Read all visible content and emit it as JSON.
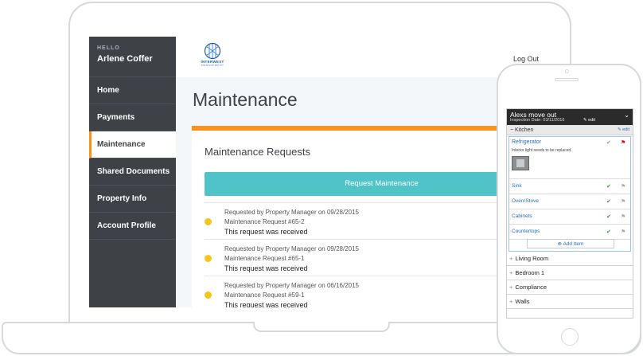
{
  "sidebar": {
    "greeting": "HELLO",
    "user_name": "Arlene Coffer",
    "items": [
      {
        "label": "Home"
      },
      {
        "label": "Payments"
      },
      {
        "label": "Maintenance"
      },
      {
        "label": "Shared Documents"
      },
      {
        "label": "Property Info"
      },
      {
        "label": "Account Profile"
      }
    ],
    "active_item": "Maintenance"
  },
  "header": {
    "logo_text": "INTERWEST",
    "logo_subtext": "MANAGEMENT",
    "logout_label": "Log Out"
  },
  "main": {
    "page_title": "Maintenance",
    "panel_title": "Maintenance Requests",
    "request_button_label": "Request Maintenance",
    "requests": [
      {
        "requested_by": "Requested by Property Manager on 09/28/2015",
        "request_id": "Maintenance Request #65-2",
        "status": "This request was received"
      },
      {
        "requested_by": "Requested by Property Manager on 09/28/2015",
        "request_id": "Maintenance Request #65-1",
        "status": "This request was received"
      },
      {
        "requested_by": "Requested by Property Manager on 06/16/2015",
        "request_id": "Maintenance Request #59-1",
        "status": "This request was received"
      }
    ]
  },
  "phone": {
    "inspection_title": "Alexs move out",
    "inspection_date": "Inspection Date: 03/11/2016",
    "edit_label": "edit",
    "kitchen": {
      "section_label": "Kitchen",
      "edit_label": "edit",
      "items": [
        {
          "name": "Refrigerator",
          "note": "Interior light needs to be replaced.",
          "flagged": true
        },
        {
          "name": "Sink",
          "flagged": false
        },
        {
          "name": "Oven/Stove",
          "flagged": false
        },
        {
          "name": "Cabinets",
          "flagged": false
        },
        {
          "name": "Countertops",
          "flagged": false
        }
      ],
      "add_item_label": "Add Item"
    },
    "collapsed_sections": [
      "Living Room",
      "Bedroom 1",
      "Compliance",
      "Walls"
    ]
  },
  "colors": {
    "sidebar_bg": "#3e4247",
    "accent_orange": "#f7941d",
    "button_teal": "#4fc3c7",
    "status_yellow": "#f5c518",
    "link_blue": "#2a6ebb"
  }
}
